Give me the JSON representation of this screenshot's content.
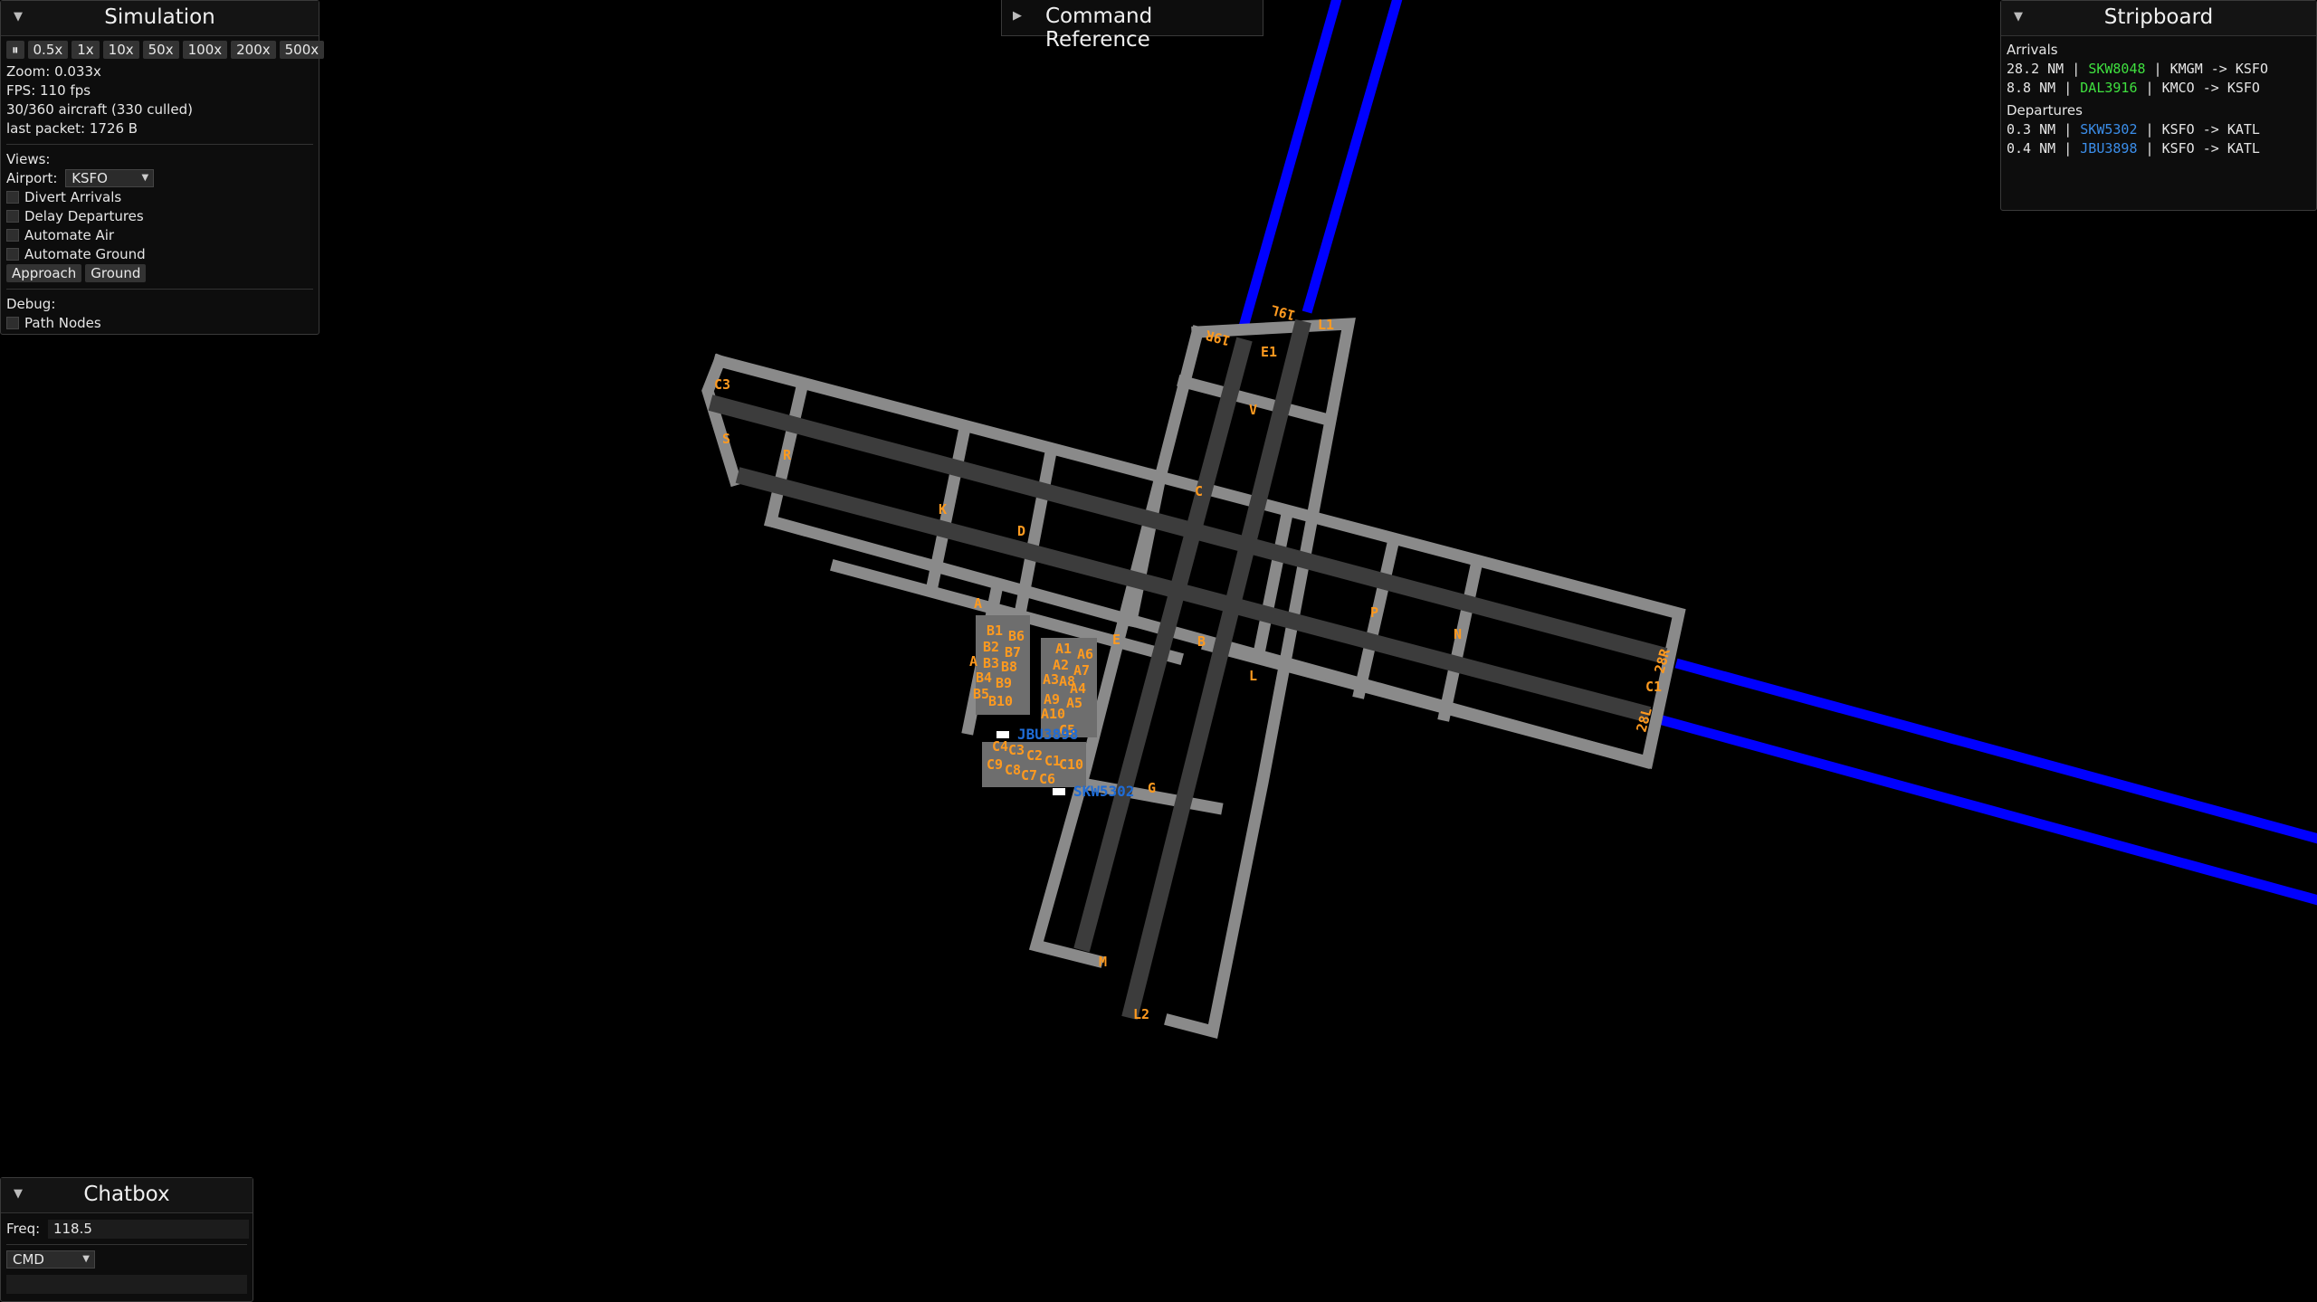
{
  "simulation": {
    "title": "Simulation",
    "speeds": [
      "0.5x",
      "1x",
      "10x",
      "50x",
      "100x",
      "200x",
      "500x"
    ],
    "stats": [
      "Zoom: 0.033x",
      "FPS: 110 fps",
      "30/360 aircraft (330 culled)",
      "last packet: 1726 B"
    ],
    "views_label": "Views:",
    "airport_label": "Airport:",
    "airport_value": "KSFO",
    "options": [
      "Divert Arrivals",
      "Delay Departures",
      "Automate Air",
      "Automate Ground"
    ],
    "buttons": [
      "Approach",
      "Ground"
    ],
    "debug_label": "Debug:",
    "debug_option": "Path Nodes"
  },
  "command_reference": {
    "title": "Command Reference"
  },
  "stripboard": {
    "title": "Stripboard",
    "arrivals_label": "Arrivals",
    "arrivals": [
      {
        "distance": "28.2 NM",
        "callsign": "SKW8048",
        "route": "KMGM -> KSFO",
        "color": "#3fe03f"
      },
      {
        "distance": "8.8 NM",
        "callsign": "DAL3916",
        "route": "KMCO -> KSFO",
        "color": "#3fe03f"
      }
    ],
    "departures_label": "Departures",
    "departures": [
      {
        "distance": "0.3 NM",
        "callsign": "SKW5302",
        "route": "KSFO -> KATL",
        "color": "#3b8eea"
      },
      {
        "distance": "0.4 NM",
        "callsign": "JBU3898",
        "route": "KSFO -> KATL",
        "color": "#3b8eea"
      }
    ]
  },
  "chatbox": {
    "title": "Chatbox",
    "freq_label": "Freq:",
    "freq_value": "118.5",
    "mode_value": "CMD"
  },
  "map": {
    "colors": {
      "runway": "#3c3c3c",
      "taxiway": "#8a8a8a",
      "approach": "#0000ff",
      "label": "#ff9a1f"
    },
    "runway_labels": [
      "19R",
      "19L",
      "28R",
      "28L"
    ],
    "taxiway_labels": [
      "C3",
      "S",
      "R",
      "K",
      "D",
      "A",
      "C",
      "V",
      "E1",
      "L1",
      "E",
      "B",
      "L",
      "G",
      "M",
      "L2",
      "P",
      "N",
      "C1"
    ],
    "gate_labels": [
      "B1",
      "B6",
      "B2",
      "B7",
      "A",
      "B3",
      "B8",
      "B4",
      "B9",
      "B5",
      "B10",
      "A1",
      "A6",
      "A2",
      "A7",
      "A3",
      "A8",
      "A4",
      "A9",
      "A5",
      "A10",
      "C5",
      "C4",
      "C3",
      "C2",
      "C1",
      "C10",
      "C9",
      "C8",
      "C7",
      "C6"
    ],
    "aircraft": [
      {
        "callsign": "JBU3898"
      },
      {
        "callsign": "SKW5302"
      }
    ]
  }
}
